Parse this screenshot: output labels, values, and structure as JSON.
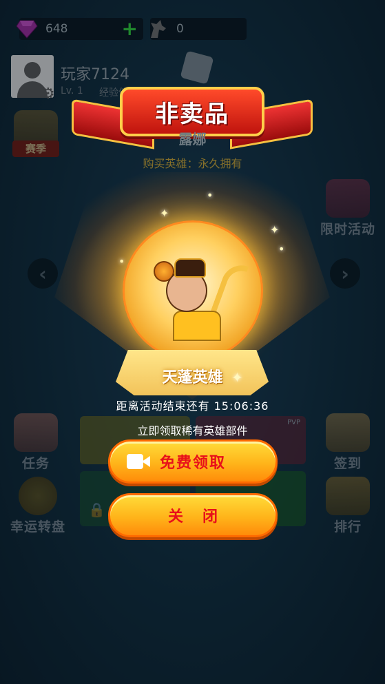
{
  "topbar": {
    "gems": "648",
    "gem_plus": "+",
    "horses": "0"
  },
  "profile": {
    "name": "玩家7124",
    "level": "Lv. 1",
    "exp_label": "经验值"
  },
  "side": {
    "season": "赛季",
    "limited_event": "限时活动",
    "task": "任务",
    "lucky_wheel": "幸运转盘",
    "sign_in": "签到",
    "rank": "排行"
  },
  "board": {
    "pvp": "PVP"
  },
  "popup": {
    "banner_title": "非卖品",
    "hero_name": "露娜",
    "hero_sub": "购买英雄：永久拥有",
    "hero_title": "天蓬英雄",
    "countdown_label": "距离活动结束还有",
    "countdown_time": "15:06:36",
    "promo": "立即领取稀有英雄部件",
    "free_button": "免费领取",
    "close_button": "关闭"
  },
  "icons": {
    "gem": "diamond-icon",
    "horse": "horse-icon",
    "gear": "gear-icon",
    "dice": "dice-icon",
    "video": "video-icon",
    "lock": "lock-icon"
  },
  "colors": {
    "button_text": "#e8101a",
    "button_fill": "#ffb41a",
    "banner_red": "#c0140e"
  }
}
